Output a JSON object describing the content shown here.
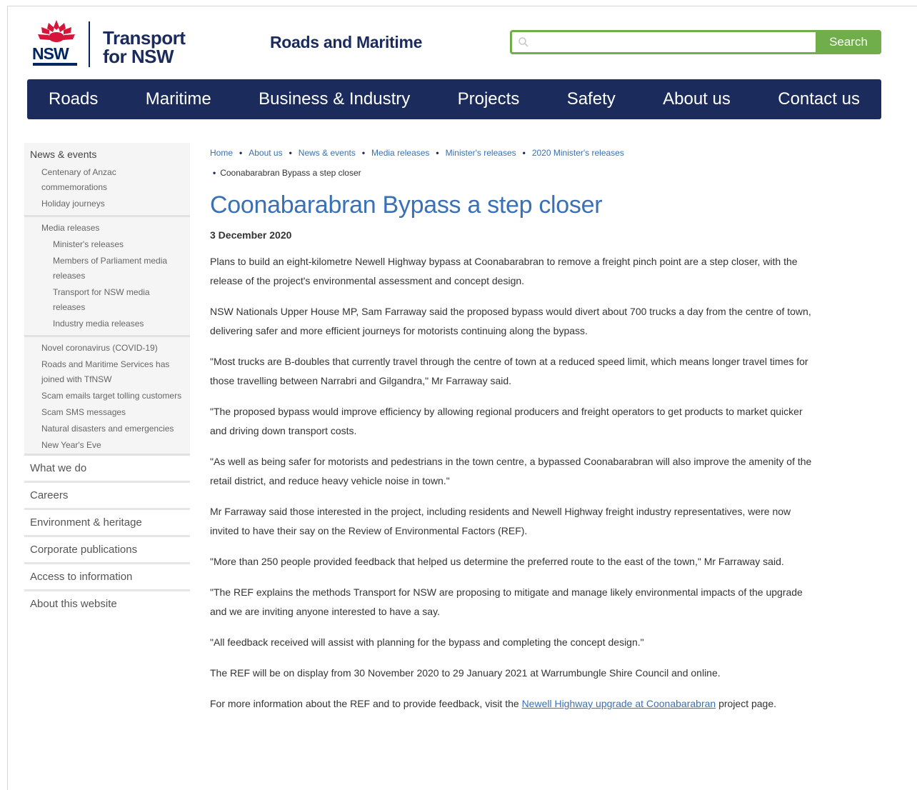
{
  "header": {
    "logo_text": "NSW",
    "brand_line1": "Transport",
    "brand_line2": "for NSW",
    "division": "Roads and Maritime",
    "search_placeholder": "",
    "search_button": "Search"
  },
  "nav": [
    "Roads",
    "Maritime",
    "Business & Industry",
    "Projects",
    "Safety",
    "About us",
    "Contact us"
  ],
  "sidebar": {
    "heading": "News & events",
    "group1": [
      "Centenary of Anzac commemorations",
      "Holiday journeys"
    ],
    "media_heading": "Media releases",
    "media_items": [
      "Minister's releases",
      "Members of Parliament media releases",
      "Transport for NSW media releases",
      "Industry media releases"
    ],
    "group2": [
      "Novel coronavirus (COVID-19)",
      "Roads and Maritime Services has joined with TfNSW",
      "Scam emails target tolling customers",
      "Scam SMS messages",
      "Natural disasters and emergencies",
      "New Year's Eve"
    ],
    "main_items": [
      "What we do",
      "Careers",
      "Environment & heritage",
      "Corporate publications",
      "Access to information",
      "About this website"
    ]
  },
  "breadcrumb": [
    "Home",
    "About us",
    "News & events",
    "Media releases",
    "Minister's releases",
    "2020 Minister's releases"
  ],
  "breadcrumb_current": "Coonabarabran Bypass a step closer",
  "article": {
    "title": "Coonabarabran Bypass a step closer",
    "date": "3 December 2020",
    "paragraphs": [
      "Plans to build an eight-kilometre Newell Highway bypass at Coonabarabran to remove a freight pinch point are a step closer, with the release of the project's environmental assessment and concept design.",
      "NSW Nationals Upper House MP, Sam Farraway said the proposed bypass would divert about 700 trucks a day from the centre of town, delivering safer and more efficient journeys for motorists continuing along the bypass.",
      "\"Most trucks are B-doubles that currently travel through the centre of town at a reduced speed limit, which means longer travel times for those travelling between Narrabri and Gilgandra,\" Mr Farraway said.",
      "\"The proposed bypass would improve efficiency by allowing regional producers and freight operators to get products to market quicker and driving down transport costs.",
      "\"As well as being safer for motorists and pedestrians in the town centre, a bypassed Coonabarabran will also improve the amenity of the retail district, and reduce heavy vehicle noise in town.\"",
      "Mr Farraway said those interested in the project, including residents and Newell Highway freight industry representatives, were now invited to have their say on the Review of Environmental Factors (REF).",
      "\"More than 250 people provided feedback that helped us determine the preferred route to the east of the town,\" Mr Farraway said.",
      "\"The REF explains the methods Transport for NSW are proposing to mitigate and manage likely environmental impacts of the upgrade and we are inviting anyone interested to have a say.",
      "\"All feedback received will assist with planning for the bypass and completing the concept design.\"",
      "The REF will be on display from 30 November 2020 to 29 January 2021 at Warrumbungle Shire Council and online."
    ],
    "last_para_before": "For more information about the REF and to provide feedback, visit the",
    "last_para_link": "Newell Highway upgrade at Coonabarabran",
    "last_para_after": "project page."
  },
  "colors": {
    "navy": "#1a2b5c",
    "green": "#6fae4a",
    "link_blue": "#3a70b5",
    "waratah_red": "#d7153a"
  }
}
